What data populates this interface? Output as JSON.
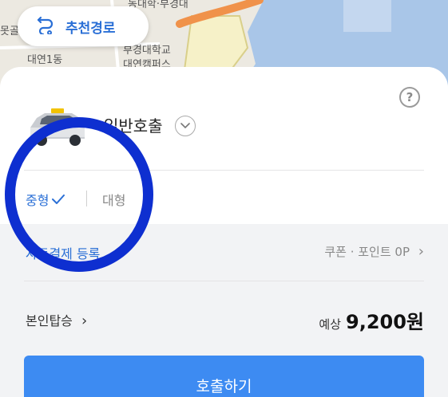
{
  "map": {
    "labels": [
      "못골",
      "대연1동",
      "부경대학교",
      "대연캠퍼스",
      "동대학·부경대"
    ]
  },
  "route_chip": {
    "label": "추천경로",
    "icon": "route-icon"
  },
  "service": {
    "name": "일반호출",
    "icon": "taxi-icon"
  },
  "help": {
    "symbol": "?"
  },
  "vehicle_size": {
    "selected": "중형",
    "other": "대형"
  },
  "payment": {
    "auto_pay_label": "자동결제 등록",
    "coupon_label": "쿠폰 · 포인트 0P",
    "chevron": "›"
  },
  "ride": {
    "self_label": "본인탑승",
    "chevron": "›"
  },
  "fare": {
    "prefix": "예상",
    "value": "9,200원"
  },
  "call_button": {
    "label": "호출하기"
  },
  "colors": {
    "accent": "#2a6fd6",
    "button": "#3d8bf2",
    "ring": "#0e2fd0",
    "route": "#f0924a"
  }
}
